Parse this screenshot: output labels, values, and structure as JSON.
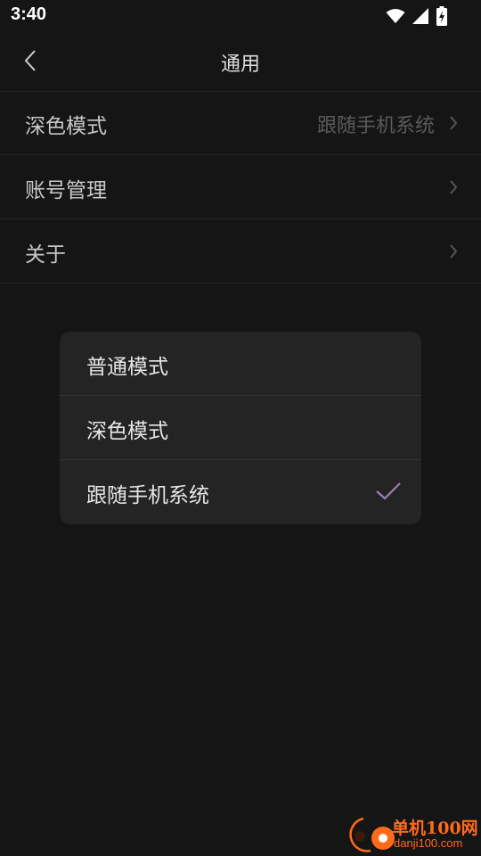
{
  "status_bar": {
    "time": "3:40",
    "icons": [
      "wifi-icon",
      "cellular-signal-icon",
      "battery-charging-icon"
    ]
  },
  "header": {
    "title": "通用",
    "back_icon": "chevron-left-icon"
  },
  "settings": [
    {
      "label": "深色模式",
      "value": "跟随手机系统"
    },
    {
      "label": "账号管理",
      "value": ""
    },
    {
      "label": "关于",
      "value": ""
    }
  ],
  "dialog": {
    "options": [
      {
        "label": "普通模式",
        "selected": false
      },
      {
        "label": "深色模式",
        "selected": false
      },
      {
        "label": "跟随手机系统",
        "selected": true
      }
    ],
    "check_icon": "checkmark-icon"
  },
  "watermark": {
    "name": "单机100网",
    "domain": "danji100.com"
  },
  "colors": {
    "background": "#151515",
    "dialog_background": "#242424",
    "accent_check": "#9b7fb8",
    "watermark": "#ff6a1a"
  }
}
